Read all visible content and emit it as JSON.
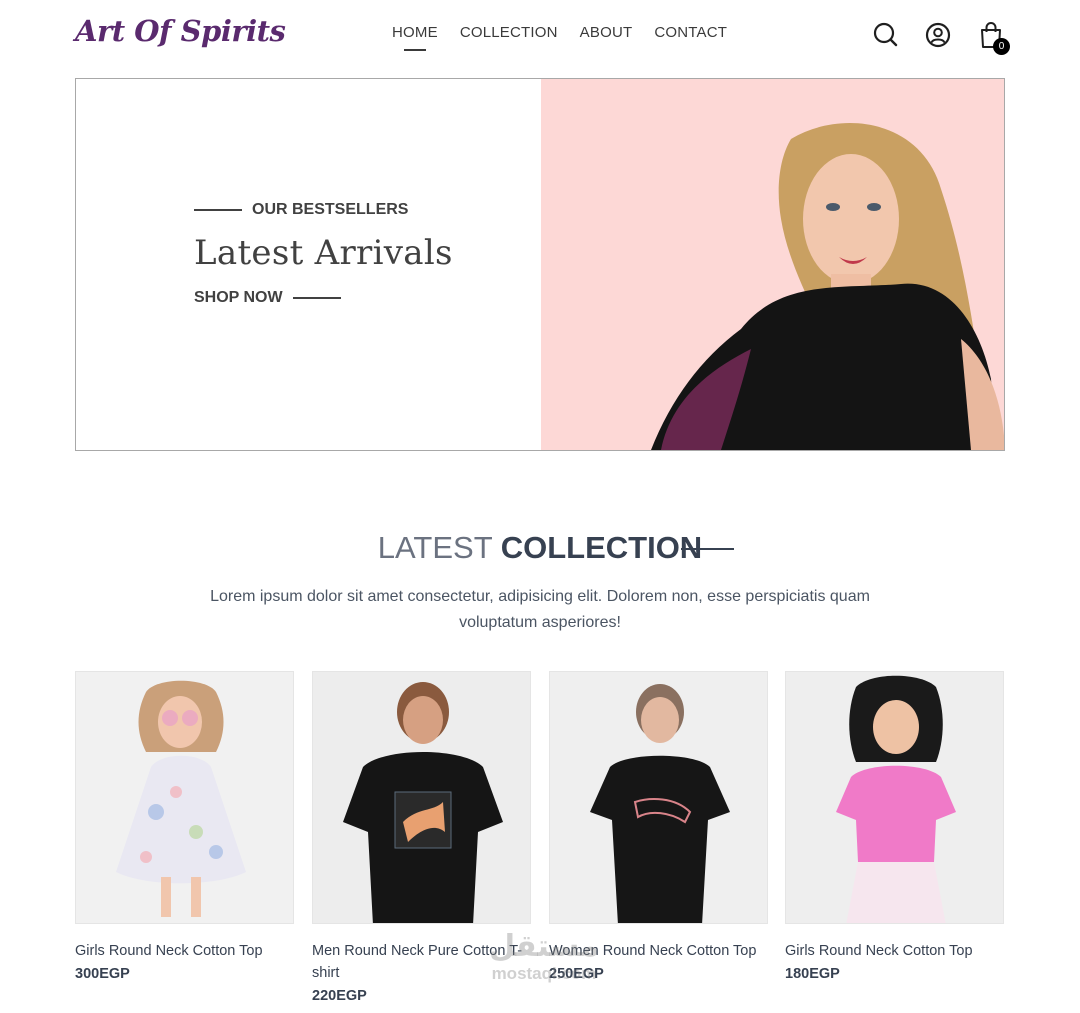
{
  "header": {
    "logo": "Art Of Spirits",
    "nav": [
      {
        "label": "HOME",
        "active": true
      },
      {
        "label": "COLLECTION",
        "active": false
      },
      {
        "label": "ABOUT",
        "active": false
      },
      {
        "label": "CONTACT",
        "active": false
      }
    ],
    "icons": [
      "search-icon",
      "user-icon",
      "shopping-bag-icon"
    ],
    "cart_count": "0"
  },
  "hero": {
    "eyebrow": "OUR BESTSELLERS",
    "title": "Latest Arrivals",
    "cta": "SHOP NOW",
    "image_bg": "#fdd8d6"
  },
  "collection": {
    "title_light": "LATEST",
    "title_bold": "COLLECTION",
    "description": "Lorem ipsum dolor sit amet consectetur, adipisicing elit. Dolorem non, esse perspiciatis quam voluptatum asperiores!",
    "products": [
      {
        "name": "Girls Round Neck Cotton Top",
        "price": "300EGP"
      },
      {
        "name": "Men Round Neck Pure Cotton T-shirt",
        "price": "220EGP"
      },
      {
        "name": "Women Round Neck Cotton Top",
        "price": "250EGP"
      },
      {
        "name": "Girls Round Neck Cotton Top",
        "price": "180EGP"
      }
    ]
  },
  "watermark": {
    "arabic": "مستقل",
    "latin": "mostaql.com"
  }
}
